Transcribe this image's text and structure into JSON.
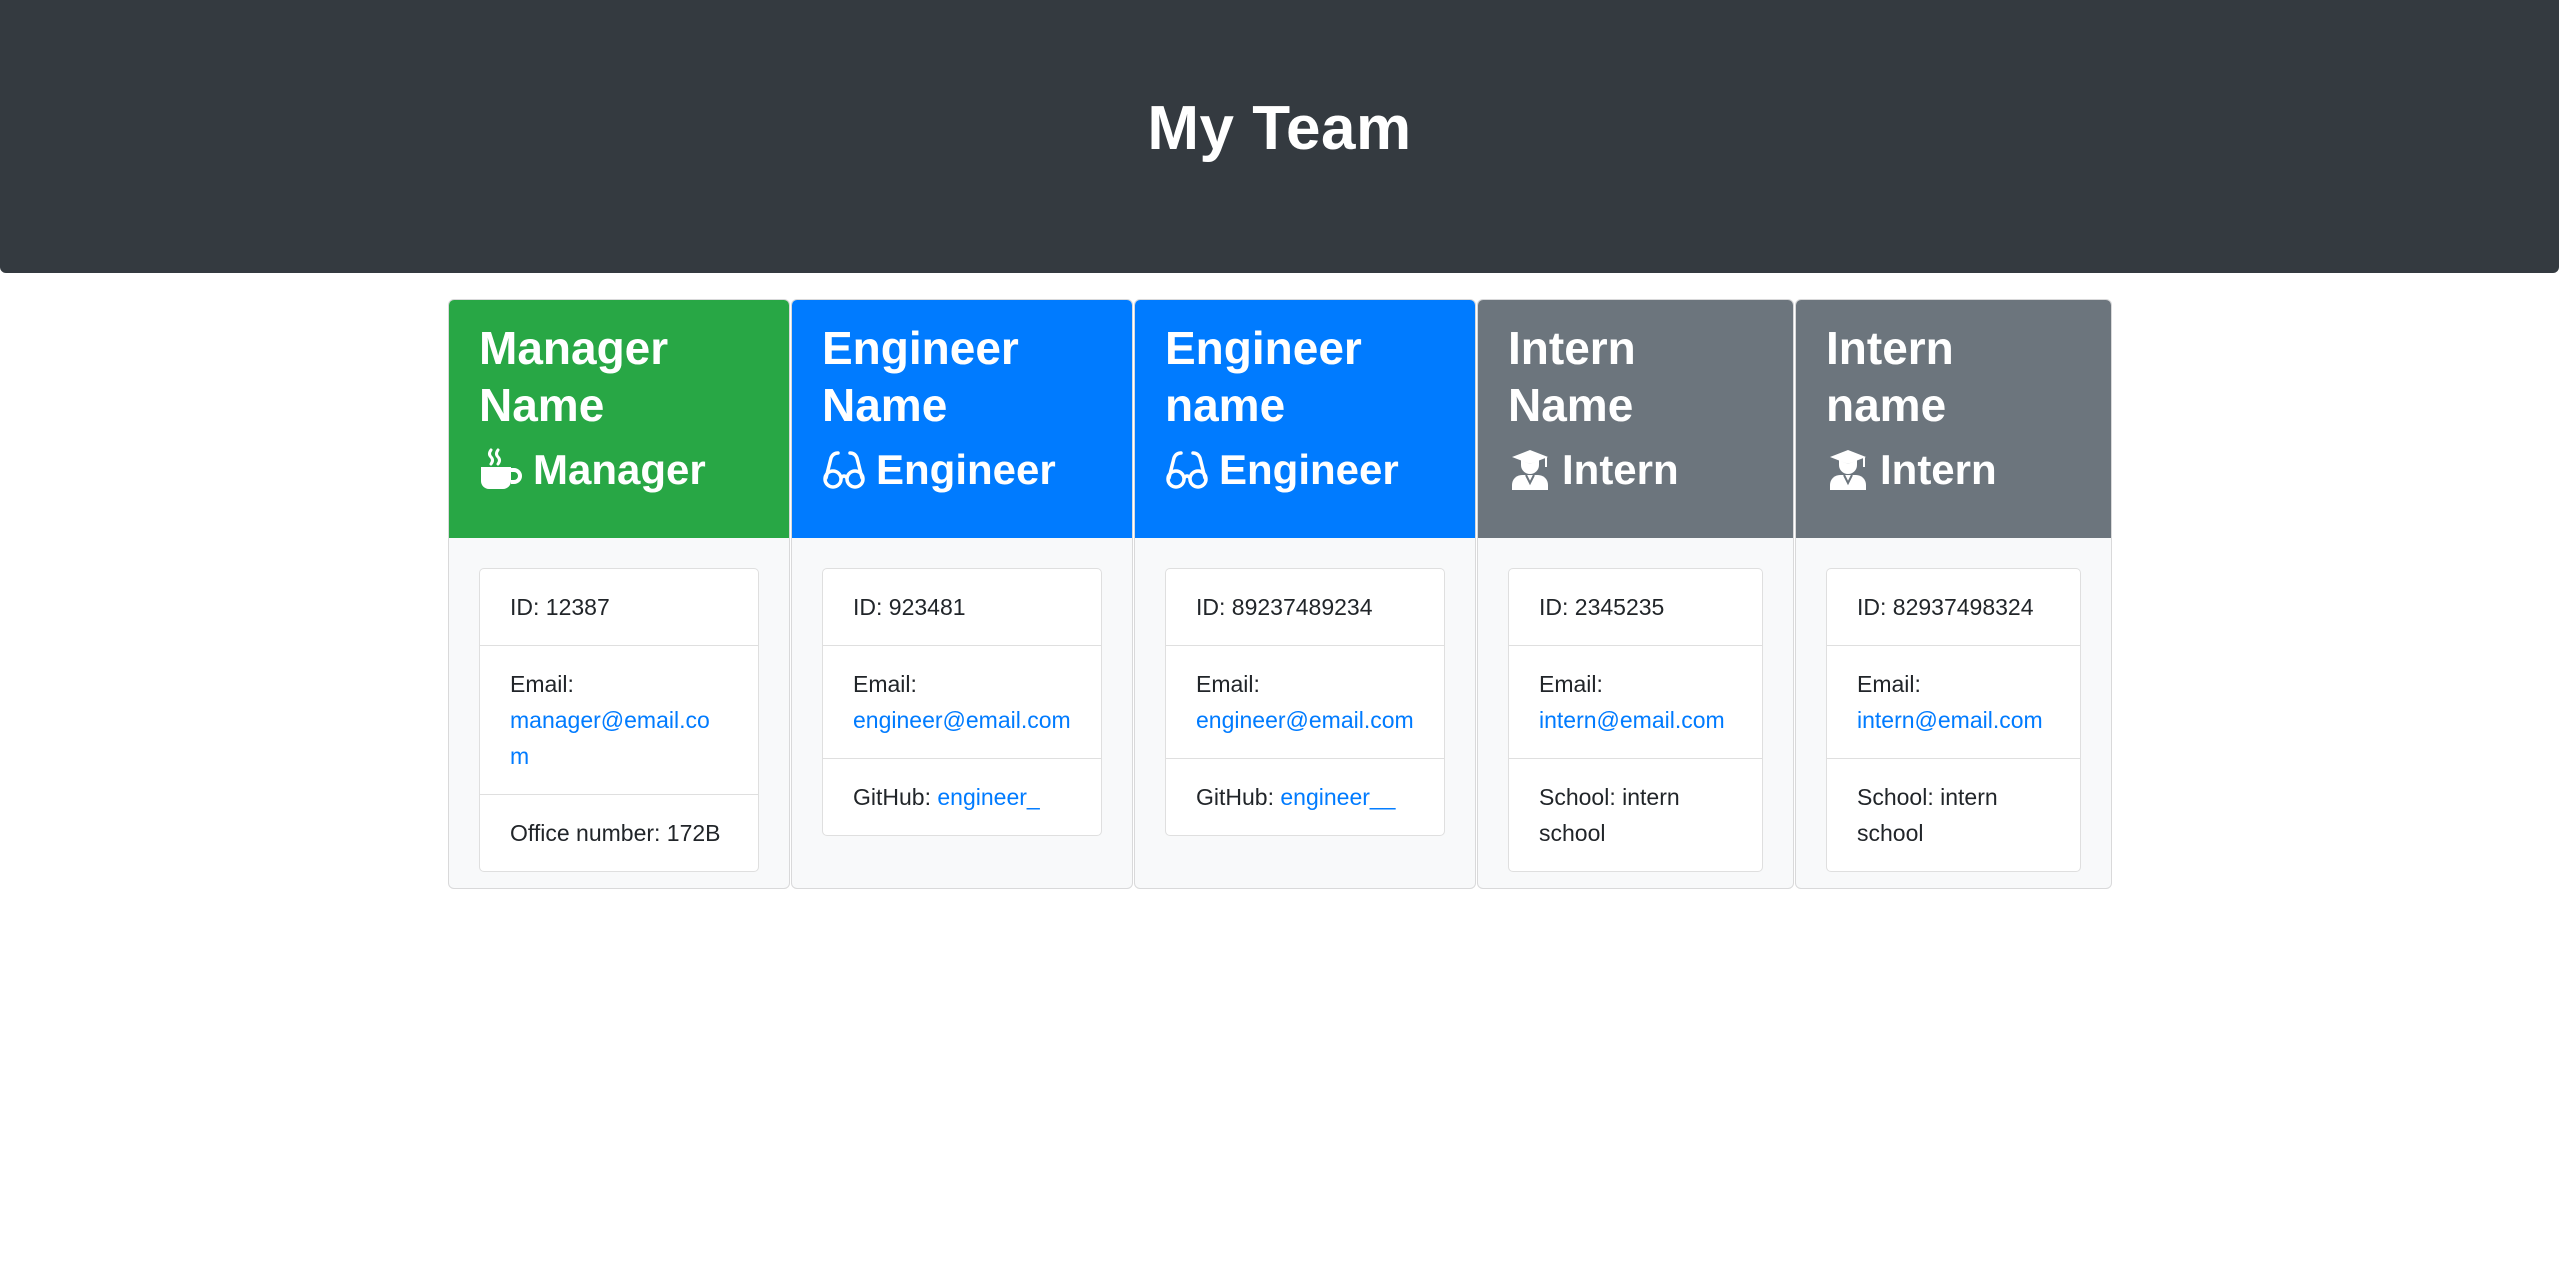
{
  "header": {
    "title": "My Team"
  },
  "colors": {
    "header_bg": "#343a40",
    "manager": "#28a745",
    "engineer": "#007bff",
    "intern": "#6c757d",
    "link": "#007bff"
  },
  "cards": [
    {
      "name": "Manager Name",
      "role": "Manager",
      "icon": "coffee-mug-icon",
      "id_label": "ID: 12387",
      "email_label": "Email:",
      "email": "manager@email.com",
      "extra_label": "Office number: 172B",
      "extra_link": ""
    },
    {
      "name": "Engineer Name",
      "role": "Engineer",
      "icon": "glasses-icon",
      "id_label": "ID: 923481",
      "email_label": "Email:",
      "email": "engineer@email.com",
      "extra_label": "GitHub:",
      "extra_link": "engineer_"
    },
    {
      "name": "Engineer name",
      "role": "Engineer",
      "icon": "glasses-icon",
      "id_label": "ID: 89237489234",
      "email_label": "Email:",
      "email": "engineer@email.com",
      "extra_label": "GitHub:",
      "extra_link": "engineer__"
    },
    {
      "name": "Intern Name",
      "role": "Intern",
      "icon": "graduate-icon",
      "id_label": "ID: 2345235",
      "email_label": "Email:",
      "email": "intern@email.com",
      "extra_label": "School: intern school",
      "extra_link": ""
    },
    {
      "name": "Intern name",
      "role": "Intern",
      "icon": "graduate-icon",
      "id_label": "ID: 82937498324",
      "email_label": "Email:",
      "email": "intern@email.com",
      "extra_label": "School: intern school",
      "extra_link": ""
    }
  ]
}
